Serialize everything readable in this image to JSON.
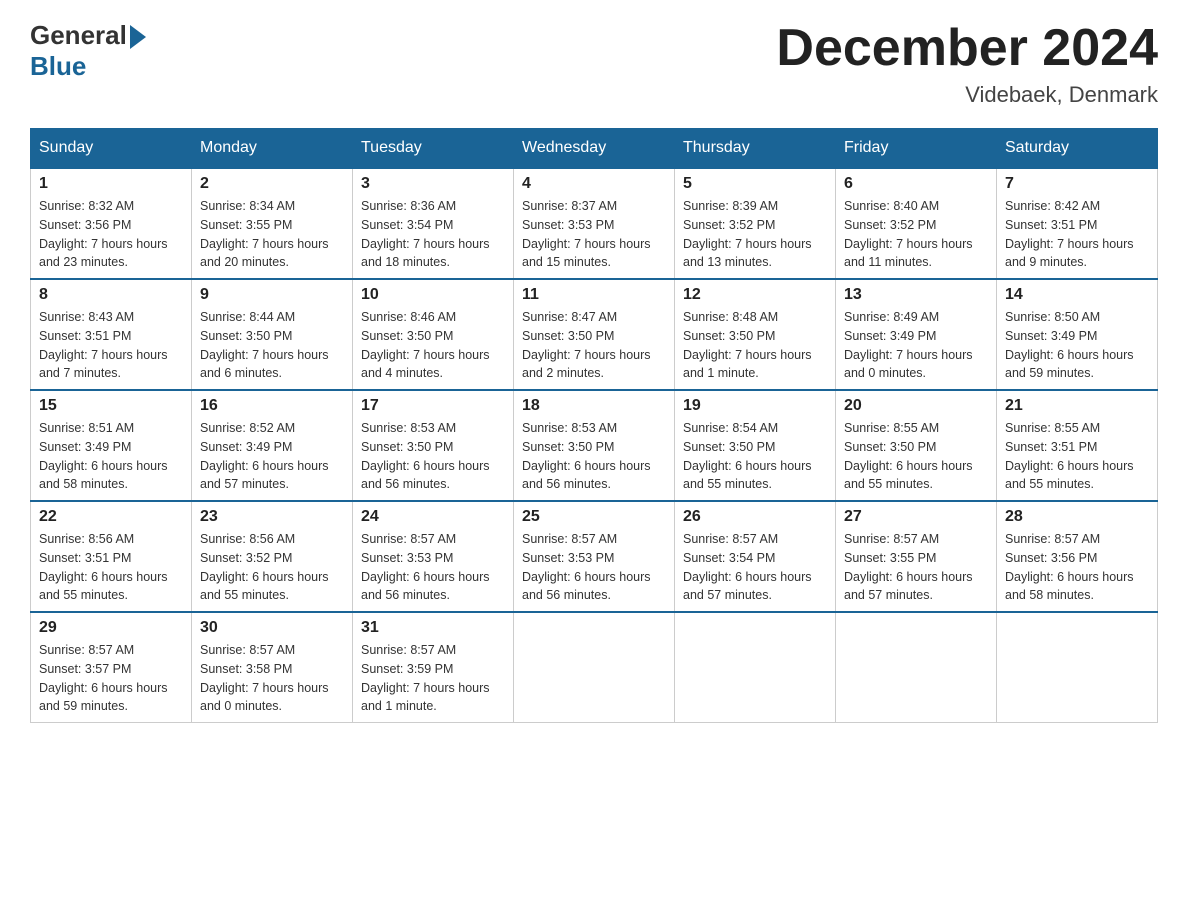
{
  "header": {
    "logo_general": "General",
    "logo_blue": "Blue",
    "month_title": "December 2024",
    "location": "Videbaek, Denmark"
  },
  "weekdays": [
    "Sunday",
    "Monday",
    "Tuesday",
    "Wednesday",
    "Thursday",
    "Friday",
    "Saturday"
  ],
  "weeks": [
    [
      {
        "day": "1",
        "sunrise": "8:32 AM",
        "sunset": "3:56 PM",
        "daylight": "7 hours and 23 minutes."
      },
      {
        "day": "2",
        "sunrise": "8:34 AM",
        "sunset": "3:55 PM",
        "daylight": "7 hours and 20 minutes."
      },
      {
        "day": "3",
        "sunrise": "8:36 AM",
        "sunset": "3:54 PM",
        "daylight": "7 hours and 18 minutes."
      },
      {
        "day": "4",
        "sunrise": "8:37 AM",
        "sunset": "3:53 PM",
        "daylight": "7 hours and 15 minutes."
      },
      {
        "day": "5",
        "sunrise": "8:39 AM",
        "sunset": "3:52 PM",
        "daylight": "7 hours and 13 minutes."
      },
      {
        "day": "6",
        "sunrise": "8:40 AM",
        "sunset": "3:52 PM",
        "daylight": "7 hours and 11 minutes."
      },
      {
        "day": "7",
        "sunrise": "8:42 AM",
        "sunset": "3:51 PM",
        "daylight": "7 hours and 9 minutes."
      }
    ],
    [
      {
        "day": "8",
        "sunrise": "8:43 AM",
        "sunset": "3:51 PM",
        "daylight": "7 hours and 7 minutes."
      },
      {
        "day": "9",
        "sunrise": "8:44 AM",
        "sunset": "3:50 PM",
        "daylight": "7 hours and 6 minutes."
      },
      {
        "day": "10",
        "sunrise": "8:46 AM",
        "sunset": "3:50 PM",
        "daylight": "7 hours and 4 minutes."
      },
      {
        "day": "11",
        "sunrise": "8:47 AM",
        "sunset": "3:50 PM",
        "daylight": "7 hours and 2 minutes."
      },
      {
        "day": "12",
        "sunrise": "8:48 AM",
        "sunset": "3:50 PM",
        "daylight": "7 hours and 1 minute."
      },
      {
        "day": "13",
        "sunrise": "8:49 AM",
        "sunset": "3:49 PM",
        "daylight": "7 hours and 0 minutes."
      },
      {
        "day": "14",
        "sunrise": "8:50 AM",
        "sunset": "3:49 PM",
        "daylight": "6 hours and 59 minutes."
      }
    ],
    [
      {
        "day": "15",
        "sunrise": "8:51 AM",
        "sunset": "3:49 PM",
        "daylight": "6 hours and 58 minutes."
      },
      {
        "day": "16",
        "sunrise": "8:52 AM",
        "sunset": "3:49 PM",
        "daylight": "6 hours and 57 minutes."
      },
      {
        "day": "17",
        "sunrise": "8:53 AM",
        "sunset": "3:50 PM",
        "daylight": "6 hours and 56 minutes."
      },
      {
        "day": "18",
        "sunrise": "8:53 AM",
        "sunset": "3:50 PM",
        "daylight": "6 hours and 56 minutes."
      },
      {
        "day": "19",
        "sunrise": "8:54 AM",
        "sunset": "3:50 PM",
        "daylight": "6 hours and 55 minutes."
      },
      {
        "day": "20",
        "sunrise": "8:55 AM",
        "sunset": "3:50 PM",
        "daylight": "6 hours and 55 minutes."
      },
      {
        "day": "21",
        "sunrise": "8:55 AM",
        "sunset": "3:51 PM",
        "daylight": "6 hours and 55 minutes."
      }
    ],
    [
      {
        "day": "22",
        "sunrise": "8:56 AM",
        "sunset": "3:51 PM",
        "daylight": "6 hours and 55 minutes."
      },
      {
        "day": "23",
        "sunrise": "8:56 AM",
        "sunset": "3:52 PM",
        "daylight": "6 hours and 55 minutes."
      },
      {
        "day": "24",
        "sunrise": "8:57 AM",
        "sunset": "3:53 PM",
        "daylight": "6 hours and 56 minutes."
      },
      {
        "day": "25",
        "sunrise": "8:57 AM",
        "sunset": "3:53 PM",
        "daylight": "6 hours and 56 minutes."
      },
      {
        "day": "26",
        "sunrise": "8:57 AM",
        "sunset": "3:54 PM",
        "daylight": "6 hours and 57 minutes."
      },
      {
        "day": "27",
        "sunrise": "8:57 AM",
        "sunset": "3:55 PM",
        "daylight": "6 hours and 57 minutes."
      },
      {
        "day": "28",
        "sunrise": "8:57 AM",
        "sunset": "3:56 PM",
        "daylight": "6 hours and 58 minutes."
      }
    ],
    [
      {
        "day": "29",
        "sunrise": "8:57 AM",
        "sunset": "3:57 PM",
        "daylight": "6 hours and 59 minutes."
      },
      {
        "day": "30",
        "sunrise": "8:57 AM",
        "sunset": "3:58 PM",
        "daylight": "7 hours and 0 minutes."
      },
      {
        "day": "31",
        "sunrise": "8:57 AM",
        "sunset": "3:59 PM",
        "daylight": "7 hours and 1 minute."
      },
      null,
      null,
      null,
      null
    ]
  ],
  "labels": {
    "sunrise": "Sunrise:",
    "sunset": "Sunset:",
    "daylight": "Daylight:"
  }
}
